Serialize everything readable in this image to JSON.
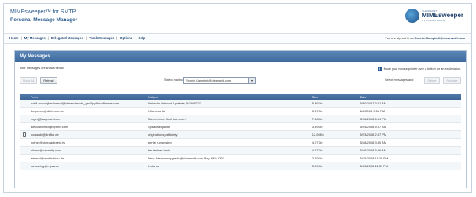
{
  "app": {
    "title": "MIMEsweeper™ for SMTP",
    "subtitle": "Personal Message Manager"
  },
  "brand": {
    "small": "CLEARSWIFT",
    "name": "MIMEsweeper",
    "tag": "# 1 in content security"
  },
  "nav": {
    "items": [
      {
        "label": "Home"
      },
      {
        "label": "My Messages"
      },
      {
        "label": "Delegated Messages"
      },
      {
        "label": "Track Messages"
      },
      {
        "label": "Options"
      },
      {
        "label": "Help"
      }
    ],
    "separator": "|",
    "signed_in_prefix": "You are signed in as",
    "signed_in_user": "Ronnie.Campbell@clearswift.com"
  },
  "panel": {
    "title": "My Messages",
    "instruction": "Your messages are shown below.",
    "info_icon": "i",
    "info_text": "Move your mouse pointer over a button for an explanation."
  },
  "toolbar": {
    "show_all": "Show All",
    "refresh": "Refresh",
    "mailbox_label": "Select mailbox:",
    "mailbox_value": "Ronnie.Campbell@clearswift.com",
    "selected_label": "Select messages and",
    "release": "Delete",
    "delete": "Release"
  },
  "table": {
    "headers": [
      "",
      "From",
      "Subject",
      "Size",
      "Date"
    ],
    "rows": [
      {
        "attach": false,
        "from": "notifi-voucmjkadlneedi@hireasdrewds_ged5pp8bnnf9mwe.com",
        "subject": "LinkedIn Network Updates, 5/29/2007",
        "size": "5.86Kb",
        "date": "5/30/2007 3:41 AM"
      },
      {
        "attach": false,
        "from": "drapeneo@dbd.com.sa",
        "subject": "leftarn varlet",
        "size": "3.37Kb",
        "date": "6/5/2008 9:56 PM"
      },
      {
        "attach": false,
        "from": "rogerj@sagmart.com",
        "subject": "Nie mehr zu flush kommen?",
        "size": "7.66Kb",
        "date": "5/26/2008 6:51 PM"
      },
      {
        "attach": false,
        "from": "alecchiformidge@trifb.com",
        "subject": "Speadaespsbrit",
        "size": "3.89Kb",
        "date": "5/24/2008 5:07 AM"
      },
      {
        "attach": true,
        "from": "howards@drefke.de",
        "subject": "originations pettiately",
        "size": "12.69Kb",
        "date": "5/23/2008 2:47 PM"
      },
      {
        "attach": false,
        "from": "pother@videoadeaeio.tv",
        "subject": "pente rumphsiept",
        "size": "4.27Kb",
        "date": "5/18/2008 3:40 AM"
      },
      {
        "attach": false,
        "from": "bilowe@canablty.com",
        "subject": "beurtnikes hauk",
        "size": "4.27Kb",
        "date": "5/16/2008 5:56 AM"
      },
      {
        "attach": false,
        "from": "letsend@worldvision.de",
        "subject": "Dear letservanupgrade@clearswift.com May 85% OFF",
        "size": "2.79Kb",
        "date": "5/15/2008 11:29 PM"
      },
      {
        "attach": false,
        "from": "ramowing@mpas.cz",
        "subject": "lextards",
        "size": "3.89Kb",
        "date": "5/13/2008 11:39 PM"
      }
    ]
  }
}
